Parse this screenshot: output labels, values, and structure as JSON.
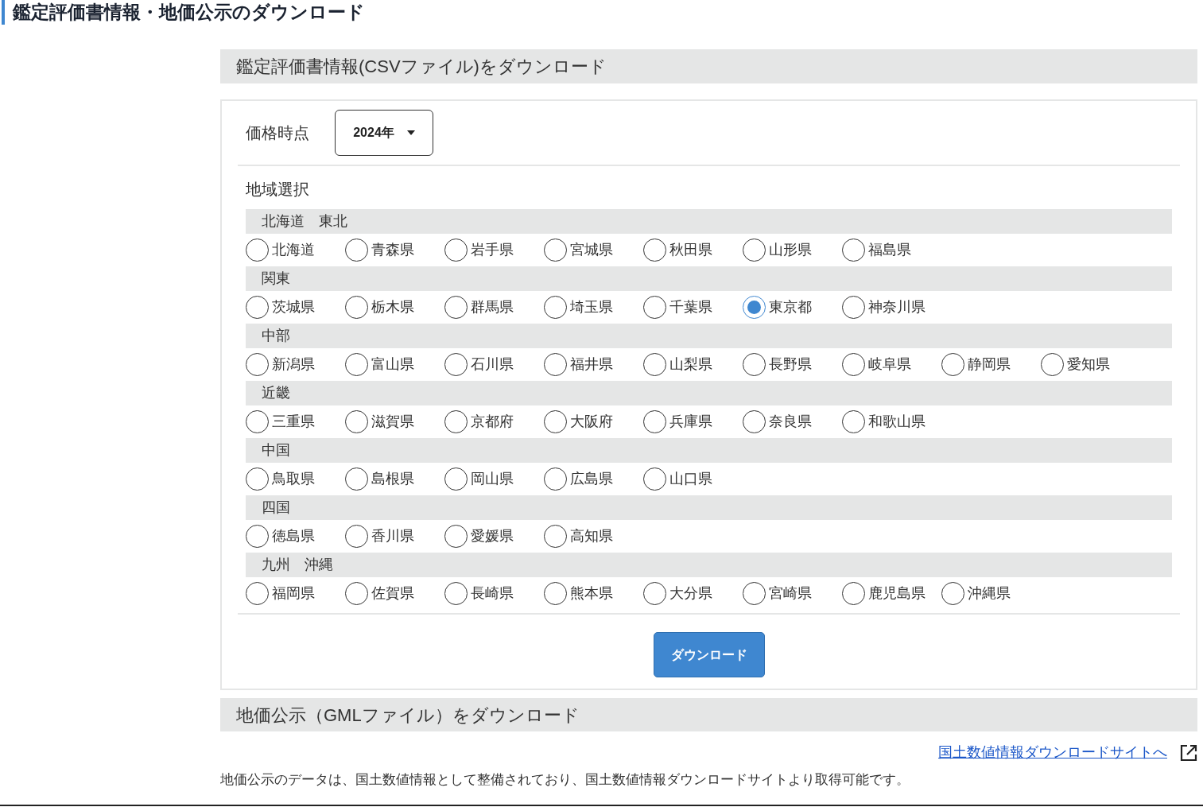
{
  "page_title": "鑑定評価書情報・地価公示のダウンロード",
  "csv_section": {
    "heading": "鑑定評価書情報(CSVファイル)をダウンロード",
    "price_time": {
      "label": "価格時点",
      "value": "2024年"
    },
    "region_label": "地域選択",
    "groups": [
      {
        "name": "北海道　東北",
        "prefectures": [
          {
            "label": "北海道",
            "selected": false
          },
          {
            "label": "青森県",
            "selected": false
          },
          {
            "label": "岩手県",
            "selected": false
          },
          {
            "label": "宮城県",
            "selected": false
          },
          {
            "label": "秋田県",
            "selected": false
          },
          {
            "label": "山形県",
            "selected": false
          },
          {
            "label": "福島県",
            "selected": false
          }
        ]
      },
      {
        "name": "関東",
        "prefectures": [
          {
            "label": "茨城県",
            "selected": false
          },
          {
            "label": "栃木県",
            "selected": false
          },
          {
            "label": "群馬県",
            "selected": false
          },
          {
            "label": "埼玉県",
            "selected": false
          },
          {
            "label": "千葉県",
            "selected": false
          },
          {
            "label": "東京都",
            "selected": true
          },
          {
            "label": "神奈川県",
            "selected": false
          }
        ]
      },
      {
        "name": "中部",
        "prefectures": [
          {
            "label": "新潟県",
            "selected": false
          },
          {
            "label": "富山県",
            "selected": false
          },
          {
            "label": "石川県",
            "selected": false
          },
          {
            "label": "福井県",
            "selected": false
          },
          {
            "label": "山梨県",
            "selected": false
          },
          {
            "label": "長野県",
            "selected": false
          },
          {
            "label": "岐阜県",
            "selected": false
          },
          {
            "label": "静岡県",
            "selected": false
          },
          {
            "label": "愛知県",
            "selected": false
          }
        ]
      },
      {
        "name": "近畿",
        "prefectures": [
          {
            "label": "三重県",
            "selected": false
          },
          {
            "label": "滋賀県",
            "selected": false
          },
          {
            "label": "京都府",
            "selected": false
          },
          {
            "label": "大阪府",
            "selected": false
          },
          {
            "label": "兵庫県",
            "selected": false
          },
          {
            "label": "奈良県",
            "selected": false
          },
          {
            "label": "和歌山県",
            "selected": false
          }
        ]
      },
      {
        "name": "中国",
        "prefectures": [
          {
            "label": "鳥取県",
            "selected": false
          },
          {
            "label": "島根県",
            "selected": false
          },
          {
            "label": "岡山県",
            "selected": false
          },
          {
            "label": "広島県",
            "selected": false
          },
          {
            "label": "山口県",
            "selected": false
          }
        ]
      },
      {
        "name": "四国",
        "prefectures": [
          {
            "label": "徳島県",
            "selected": false
          },
          {
            "label": "香川県",
            "selected": false
          },
          {
            "label": "愛媛県",
            "selected": false
          },
          {
            "label": "高知県",
            "selected": false
          }
        ]
      },
      {
        "name": "九州　沖縄",
        "prefectures": [
          {
            "label": "福岡県",
            "selected": false
          },
          {
            "label": "佐賀県",
            "selected": false
          },
          {
            "label": "長崎県",
            "selected": false
          },
          {
            "label": "熊本県",
            "selected": false
          },
          {
            "label": "大分県",
            "selected": false
          },
          {
            "label": "宮崎県",
            "selected": false
          },
          {
            "label": "鹿児島県",
            "selected": false
          },
          {
            "label": "沖縄県",
            "selected": false
          }
        ]
      }
    ],
    "download_button": "ダウンロード"
  },
  "gml_section": {
    "heading": "地価公示（GMLファイル）をダウンロード",
    "link": "国土数値情報ダウンロードサイトへ",
    "description": "地価公示のデータは、国土数値情報として整備されており、国土数値情報ダウンロードサイトより取得可能です。"
  }
}
